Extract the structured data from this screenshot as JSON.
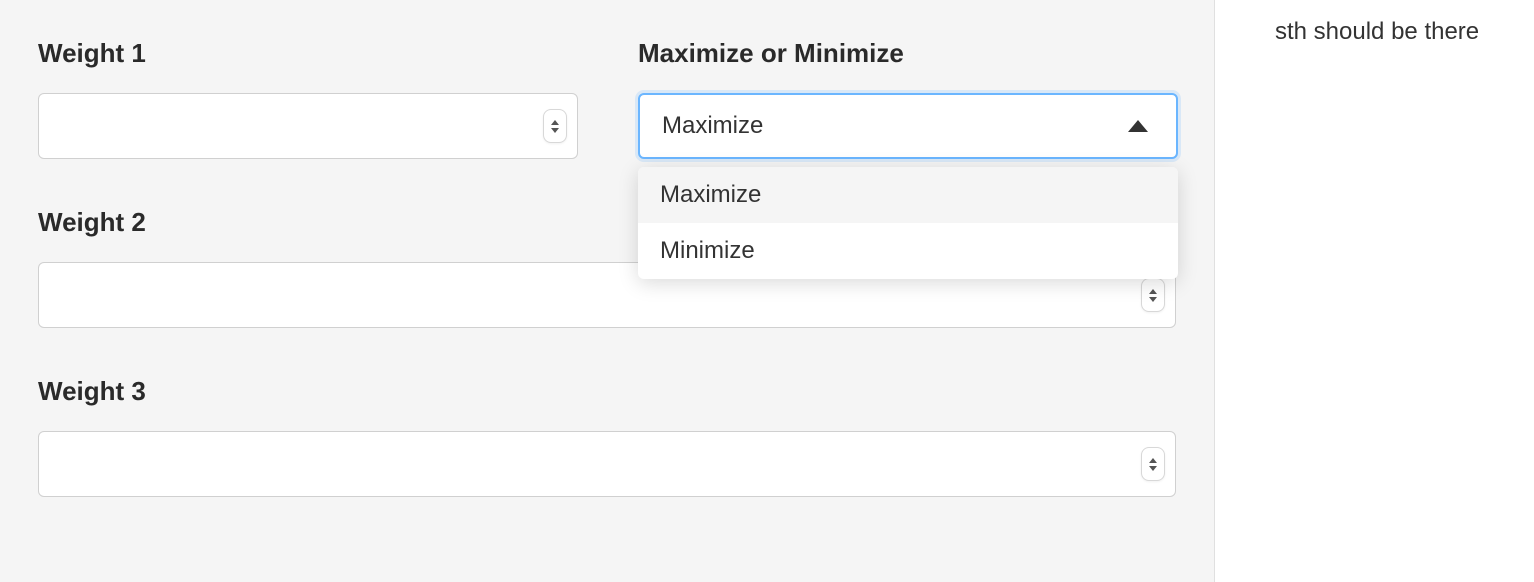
{
  "form": {
    "weight1": {
      "label": "Weight 1",
      "value": ""
    },
    "weight2": {
      "label": "Weight 2",
      "value": ""
    },
    "weight3": {
      "label": "Weight 3",
      "value": ""
    },
    "maxmin": {
      "label": "Maximize or Minimize",
      "selected": "Maximize",
      "options": [
        "Maximize",
        "Minimize"
      ]
    }
  },
  "side": {
    "note": "sth should be there"
  }
}
